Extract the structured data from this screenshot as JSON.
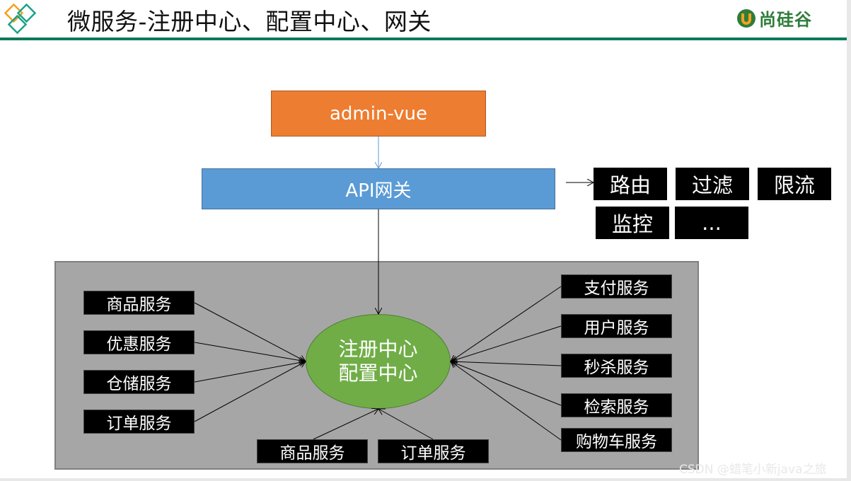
{
  "header": {
    "title": "微服务-注册中心、配置中心、网关",
    "logo_text": "尚硅谷",
    "colors": {
      "accent_line": "#0e7a5a",
      "logo_orange": "#f4a11c",
      "logo_teal": "#1aa38a"
    }
  },
  "diagram": {
    "frontend": {
      "label": "admin-vue",
      "color": "#ed7d31"
    },
    "gateway": {
      "label": "API网关",
      "color": "#5b9bd5"
    },
    "gateway_features": [
      "路由",
      "过滤",
      "限流",
      "监控",
      "..."
    ],
    "center": {
      "line1": "注册中心",
      "line2": "配置中心",
      "color": "#70ad47"
    },
    "left_services": [
      "商品服务",
      "优惠服务",
      "仓储服务",
      "订单服务"
    ],
    "bottom_services": [
      "商品服务",
      "订单服务"
    ],
    "right_services": [
      "支付服务",
      "用户服务",
      "秒杀服务",
      "检索服务",
      "购物车服务"
    ],
    "edges": [
      {
        "from": "admin-vue",
        "to": "API网关"
      },
      {
        "from": "API网关",
        "to": "注册中心/配置中心"
      },
      {
        "from": "API网关",
        "to": "路由"
      },
      {
        "from": "商品服务",
        "to": "注册中心/配置中心"
      },
      {
        "from": "优惠服务",
        "to": "注册中心/配置中心"
      },
      {
        "from": "仓储服务",
        "to": "注册中心/配置中心"
      },
      {
        "from": "订单服务",
        "to": "注册中心/配置中心"
      },
      {
        "from": "支付服务",
        "to": "注册中心/配置中心"
      },
      {
        "from": "用户服务",
        "to": "注册中心/配置中心"
      },
      {
        "from": "秒杀服务",
        "to": "注册中心/配置中心"
      },
      {
        "from": "检索服务",
        "to": "注册中心/配置中心"
      },
      {
        "from": "购物车服务",
        "to": "注册中心/配置中心"
      },
      {
        "from": "商品服务 (bottom)",
        "to": "注册中心/配置中心"
      },
      {
        "from": "订单服务 (bottom)",
        "to": "注册中心/配置中心"
      }
    ]
  },
  "watermark": "CSDN @蜡笔小新java之旅"
}
